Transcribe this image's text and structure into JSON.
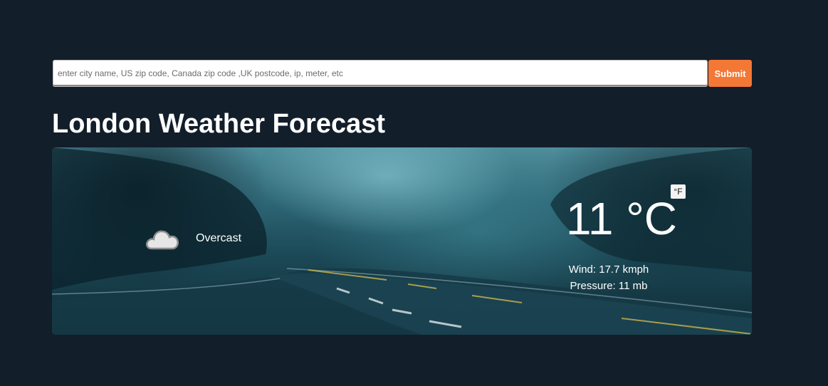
{
  "search": {
    "placeholder": "enter city name, US zip code, Canada zip code ,UK postcode, ip, meter, etc",
    "value": "",
    "submit_label": "Submit"
  },
  "page": {
    "title": "London Weather Forecast"
  },
  "weather": {
    "condition": "Overcast",
    "condition_icon": "cloud-icon",
    "temperature": "11 °C",
    "unit_toggle_label": "°F",
    "wind": "Wind: 17.7 kmph",
    "pressure": "Pressure: 11 mb"
  },
  "colors": {
    "background": "#121e2a",
    "accent": "#f37735",
    "text": "#ffffff"
  }
}
